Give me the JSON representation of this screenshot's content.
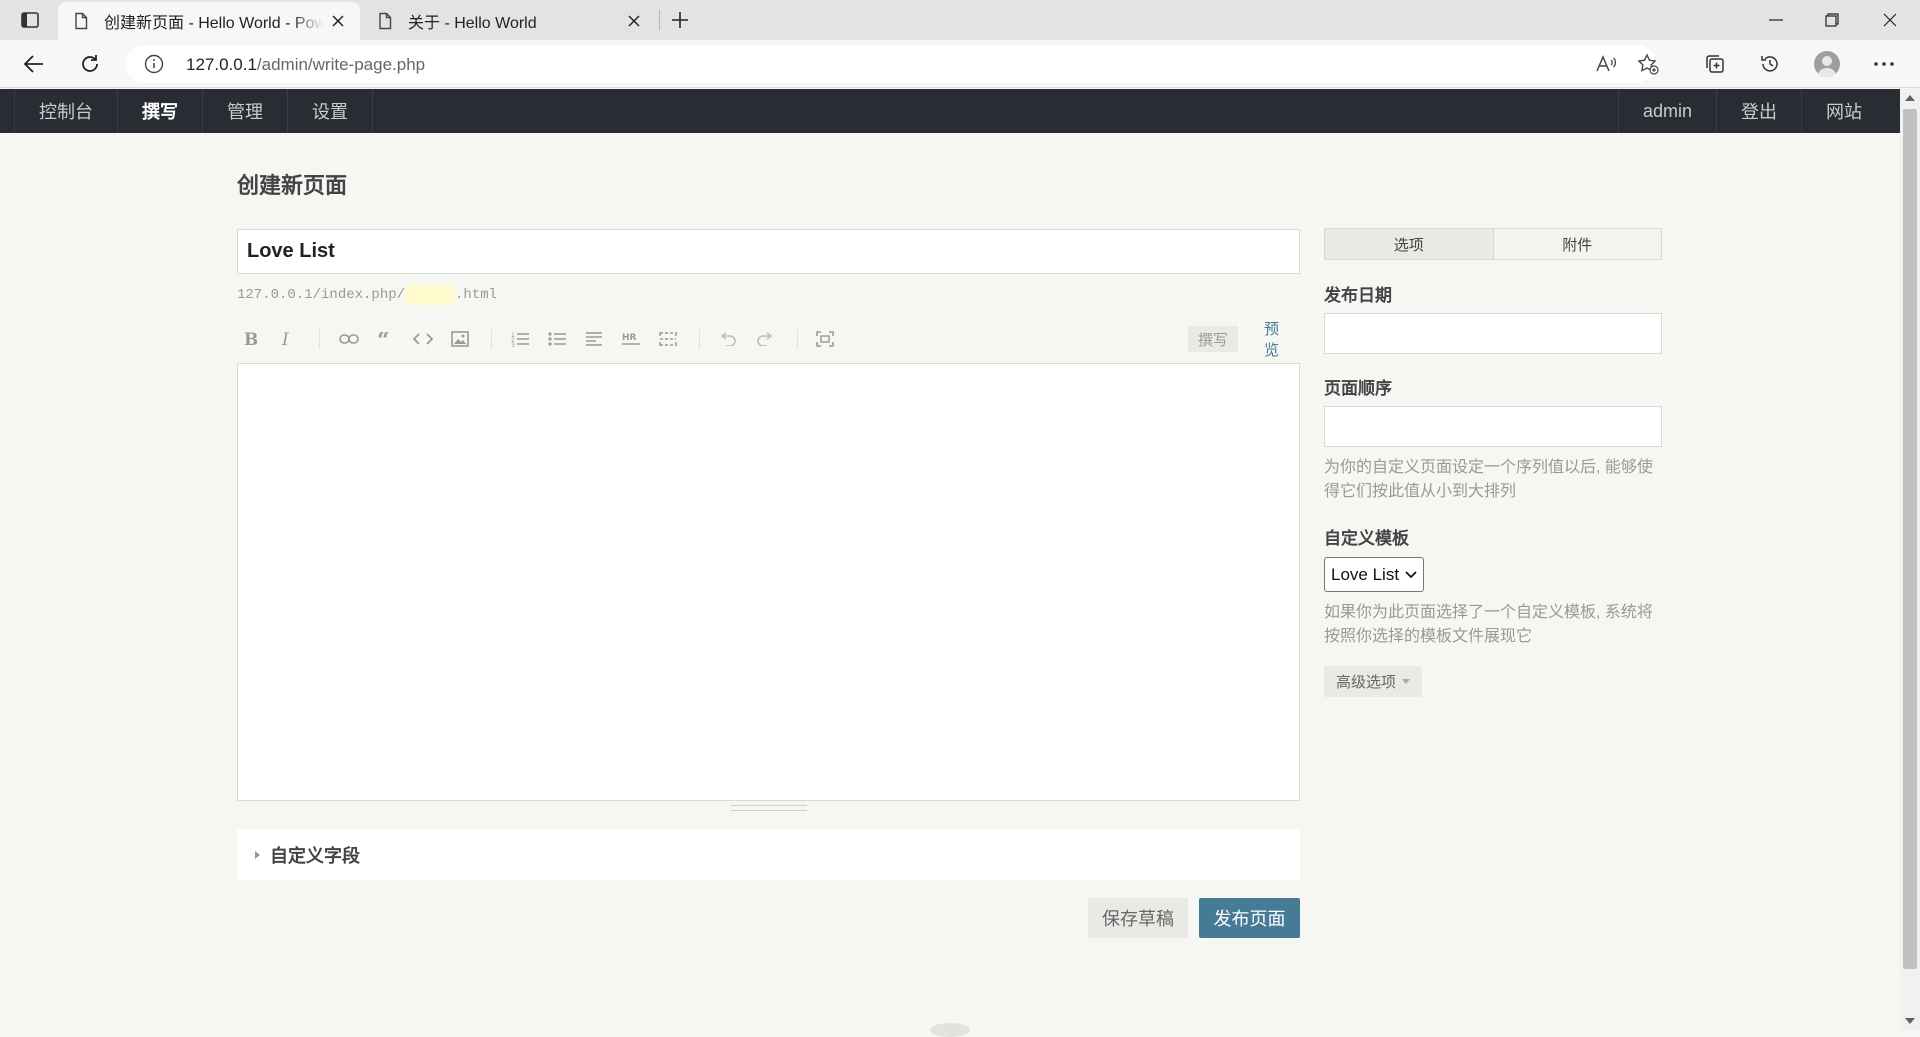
{
  "browser": {
    "tabs": [
      {
        "title": "创建新页面 - Hello World - Powered by Typecho",
        "active": true
      },
      {
        "title": "关于 - Hello World",
        "active": false
      }
    ],
    "url_host": "127.0.0.1",
    "url_path": "/admin/write-page.php"
  },
  "admin_menu": {
    "left": [
      "控制台",
      "撰写",
      "管理",
      "设置"
    ],
    "current": "撰写",
    "right": [
      "admin",
      "登出",
      "网站"
    ]
  },
  "page": {
    "heading": "创建新页面",
    "title_value": "Love List",
    "slug_prefix": "127.0.0.1/index.php/",
    "slug_suffix": ".html",
    "editor_modes": {
      "write": "撰写",
      "preview": "预览"
    },
    "custom_fields_label": "自定义字段",
    "save_draft_label": "保存草稿",
    "publish_label": "发布页面"
  },
  "sidebar": {
    "tabs": [
      "选项",
      "附件"
    ],
    "publish_date_label": "发布日期",
    "order_label": "页面顺序",
    "order_desc": "为你的自定义页面设定一个序列值以后, 能够使得它们按此值从小到大排列",
    "template_label": "自定义模板",
    "template_selected": "Love List",
    "template_desc": "如果你为此页面选择了一个自定义模板, 系统将按照你选择的模板文件展现它",
    "advanced_label": "高级选项"
  },
  "colors": {
    "accent": "#467b96",
    "admin_bar": "#292d33",
    "page_bg": "#f6f6f3"
  }
}
